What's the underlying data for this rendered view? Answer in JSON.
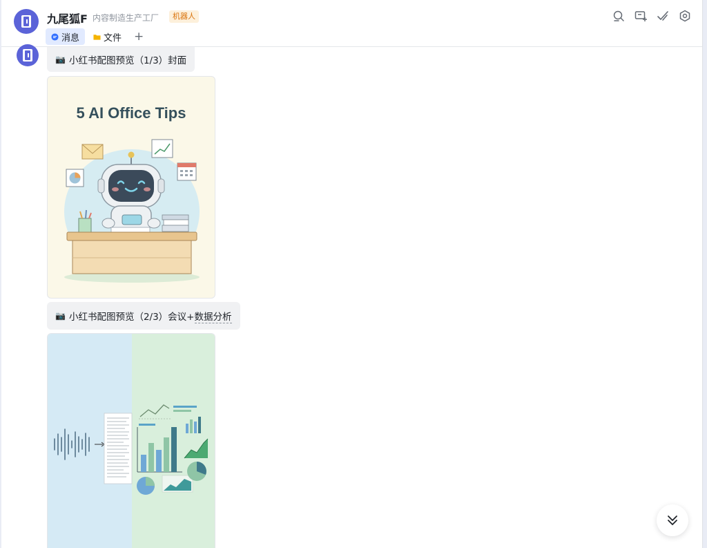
{
  "header": {
    "chat_name": "九尾狐F",
    "subtitle": "内容制造生产工厂",
    "badge": "机器人",
    "tabs": [
      {
        "label": "消息",
        "active": true
      },
      {
        "label": "文件",
        "active": false
      }
    ],
    "toolbar_icons": [
      "search-icon",
      "add-screen-icon",
      "pen-check-icon",
      "settings-icon"
    ]
  },
  "messages": [
    {
      "text": "小红书配图预览（1/3）封面",
      "image_title": "5 AI Office Tips"
    },
    {
      "text_prefix": "小红书配图预览（2/3）会议+",
      "text_underlined": "数据分析"
    }
  ],
  "colors": {
    "accent": "#3370ff",
    "avatar": "#5b63d8",
    "badge_text": "#d9730d",
    "badge_bg": "#fdf0db"
  }
}
